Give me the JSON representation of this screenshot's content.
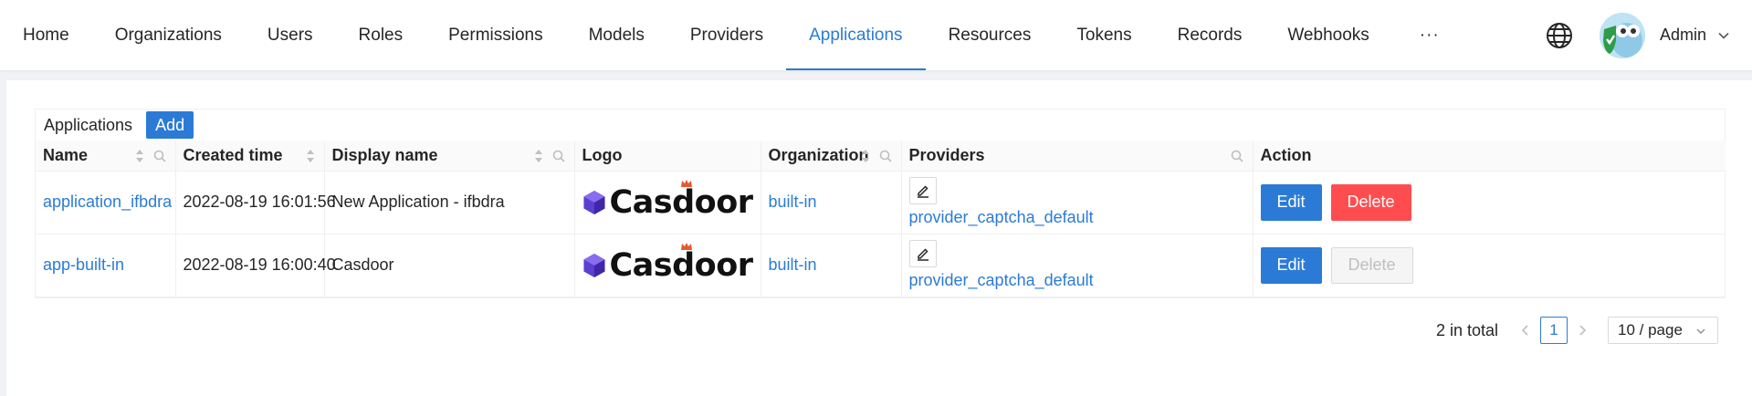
{
  "nav": {
    "items": [
      {
        "label": "Home"
      },
      {
        "label": "Organizations"
      },
      {
        "label": "Users"
      },
      {
        "label": "Roles"
      },
      {
        "label": "Permissions"
      },
      {
        "label": "Models"
      },
      {
        "label": "Providers"
      },
      {
        "label": "Applications",
        "active": true
      },
      {
        "label": "Resources"
      },
      {
        "label": "Tokens"
      },
      {
        "label": "Records"
      },
      {
        "label": "Webhooks"
      },
      {
        "label": "···"
      }
    ],
    "user": "Admin"
  },
  "table": {
    "title": "Applications",
    "add_label": "Add",
    "columns": [
      "Name",
      "Created time",
      "Display name",
      "Logo",
      "Organization",
      "Providers",
      "Action"
    ],
    "rows": [
      {
        "name": "application_ifbdra",
        "created": "2022-08-19 16:01:56",
        "display_name": "New Application - ifbdra",
        "logo_text": "Casdoor",
        "organization": "built-in",
        "provider": "provider_captcha_default",
        "edit_label": "Edit",
        "delete_label": "Delete",
        "delete_enabled": true
      },
      {
        "name": "app-built-in",
        "created": "2022-08-19 16:00:40",
        "display_name": "Casdoor",
        "logo_text": "Casdoor",
        "organization": "built-in",
        "provider": "provider_captcha_default",
        "edit_label": "Edit",
        "delete_label": "Delete",
        "delete_enabled": false
      }
    ]
  },
  "pagination": {
    "total": "2 in total",
    "current": "1",
    "page_size": "10 / page"
  },
  "colors": {
    "primary": "#2b7bd6",
    "danger": "#ff4d4f"
  }
}
